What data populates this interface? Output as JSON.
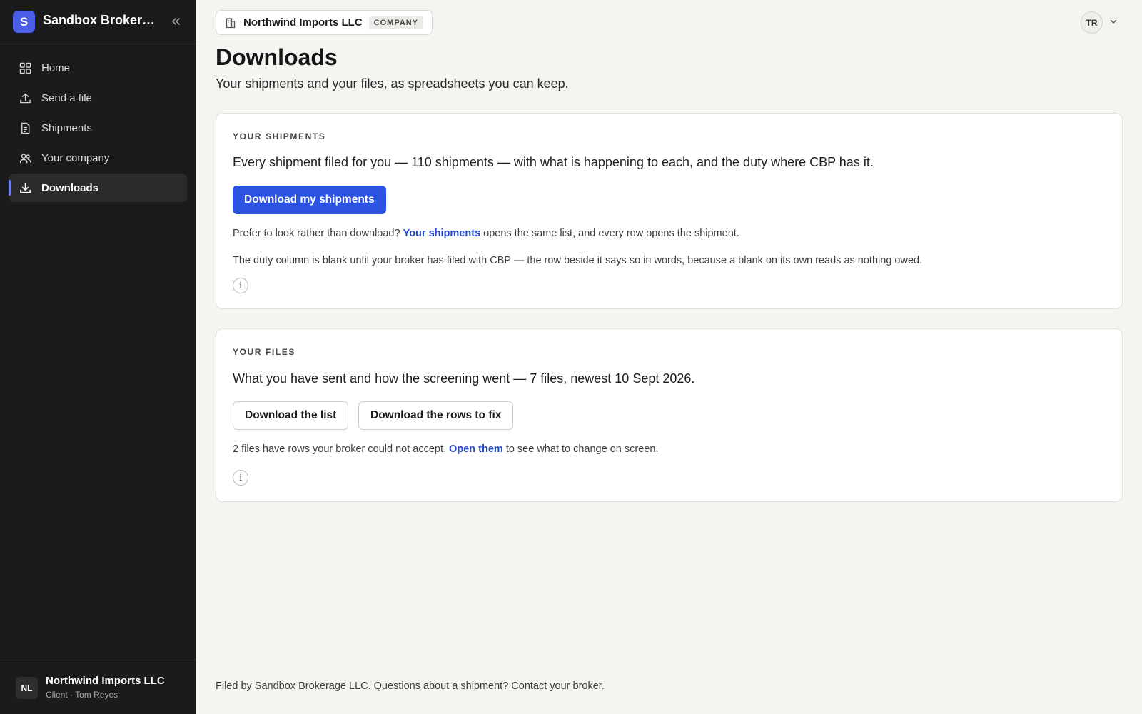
{
  "sidebar": {
    "brand_initial": "S",
    "brand_name": "Sandbox Brokerag...",
    "nav": [
      {
        "label": "Home",
        "icon": "home-grid-icon"
      },
      {
        "label": "Send a file",
        "icon": "upload-icon"
      },
      {
        "label": "Shipments",
        "icon": "document-icon"
      },
      {
        "label": "Your company",
        "icon": "users-icon"
      },
      {
        "label": "Downloads",
        "icon": "download-icon",
        "active": true
      }
    ],
    "footer": {
      "initials": "NL",
      "name": "Northwind Imports LLC",
      "subtitle": "Client · Tom Reyes"
    }
  },
  "header": {
    "company_name": "Northwind Imports LLC",
    "company_badge": "COMPANY",
    "user_initials": "TR"
  },
  "page": {
    "title": "Downloads",
    "subtitle": "Your shipments and your files, as spreadsheets you can keep."
  },
  "shipments_card": {
    "eyebrow": "YOUR SHIPMENTS",
    "lead": "Every shipment filed for you — 110 shipments — with what is happening to each, and the duty where CBP has it.",
    "button": "Download my shipments",
    "note_prefix": "Prefer to look rather than download?",
    "note_link": "Your shipments",
    "note_suffix": "opens the same list, and every row opens the shipment.",
    "duty_note": "The duty column is blank until your broker has filed with CBP — the row beside it says so in words, because a blank on its own reads as nothing owed.",
    "info": "i"
  },
  "files_card": {
    "eyebrow": "YOUR FILES",
    "lead": "What you have sent and how the screening went — 7 files, newest 10 Sept 2026.",
    "button_list": "Download the list",
    "button_fix": "Download the rows to fix",
    "note_prefix": "2 files have rows your broker could not accept.",
    "note_link": "Open them",
    "note_suffix": "to see what to change on screen.",
    "info": "i"
  },
  "footer": {
    "text": "Filed by Sandbox Brokerage LLC. Questions about a shipment? Contact your broker."
  },
  "colors": {
    "sidebar_bg": "#1b1b1b",
    "accent": "#2b52e0",
    "link": "#2148c9",
    "page_bg": "#f5f4f1"
  }
}
